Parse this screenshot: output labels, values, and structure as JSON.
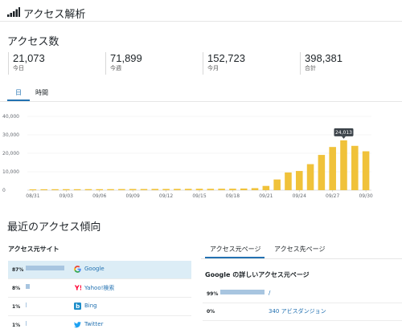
{
  "header": {
    "title": "アクセス解析",
    "icon": "signal-bars-icon"
  },
  "access_count": {
    "title": "アクセス数",
    "stats": [
      {
        "value": "21,073",
        "label": "今日"
      },
      {
        "value": "71,899",
        "label": "今週"
      },
      {
        "value": "152,723",
        "label": "今月"
      },
      {
        "value": "398,381",
        "label": "合計"
      }
    ]
  },
  "tabs": [
    {
      "label": "日",
      "active": true
    },
    {
      "label": "時間",
      "active": false
    }
  ],
  "tooltip": {
    "value": "24,013"
  },
  "chart_data": {
    "type": "bar",
    "x": [
      "08/31",
      "09/01",
      "09/02",
      "09/03",
      "09/04",
      "09/05",
      "09/06",
      "09/07",
      "09/08",
      "09/09",
      "09/10",
      "09/11",
      "09/12",
      "09/13",
      "09/14",
      "09/15",
      "09/16",
      "09/17",
      "09/18",
      "09/19",
      "09/20",
      "09/21",
      "09/22",
      "09/23",
      "09/24",
      "09/25",
      "09/26",
      "09/27",
      "09/28",
      "09/29",
      "09/30"
    ],
    "values": [
      450,
      500,
      520,
      540,
      520,
      560,
      540,
      560,
      600,
      640,
      620,
      680,
      660,
      700,
      720,
      760,
      740,
      780,
      800,
      900,
      1100,
      2300,
      5800,
      9600,
      10400,
      14100,
      19100,
      23400,
      27000,
      24013,
      21073
    ],
    "xtick_labels": [
      "08/31",
      "09/03",
      "09/06",
      "09/09",
      "09/12",
      "09/15",
      "09/18",
      "09/21",
      "09/24",
      "09/27",
      "09/30"
    ],
    "yticks": [
      "0",
      "10,000",
      "20,000",
      "30,000",
      "40,000"
    ],
    "ylim": [
      0,
      40000
    ],
    "color": "#f0c23a",
    "highlight_index": 28
  },
  "trends": {
    "title": "最近のアクセス傾向",
    "sources_title": "アクセス元サイト",
    "sources": [
      {
        "pct": "87%",
        "fraction": 0.87,
        "name": "Google",
        "icon": "google-icon",
        "active": true
      },
      {
        "pct": "8%",
        "fraction": 0.08,
        "name": "Yahoo!検索",
        "icon": "yahoo-icon",
        "active": false
      },
      {
        "pct": "1%",
        "fraction": 0.01,
        "name": "Bing",
        "icon": "bing-icon",
        "active": false
      },
      {
        "pct": "1%",
        "fraction": 0.01,
        "name": "Twitter",
        "icon": "twitter-icon",
        "active": false
      }
    ],
    "right_tabs": [
      {
        "label": "アクセス元ページ",
        "active": true
      },
      {
        "label": "アクセス先ページ",
        "active": false
      }
    ],
    "pages_title": "Google の詳しいアクセス元ページ",
    "pages": [
      {
        "pct": "99%",
        "fraction": 0.99,
        "name": "/"
      },
      {
        "pct": "0%",
        "fraction": 0.0,
        "name": "340 アビスダンジョン"
      }
    ]
  }
}
